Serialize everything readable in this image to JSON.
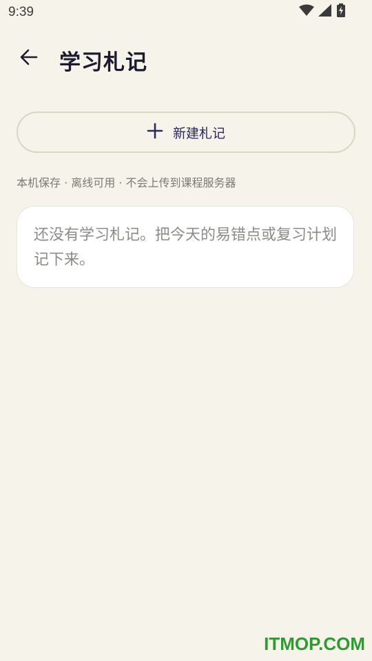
{
  "status_bar": {
    "time": "9:39",
    "icons": [
      "wifi-icon",
      "cellular-signal-icon",
      "battery-charging-icon"
    ]
  },
  "app_bar": {
    "back_icon": "arrow-left-icon",
    "title": "学习札记"
  },
  "actions": {
    "new_note_label": "新建札记",
    "new_note_icon": "plus-icon"
  },
  "storage_hint": "本机保存 · 离线可用 · 不会上传到课程服务器",
  "empty_state": {
    "message": "还没有学习札记。把今天的易错点或复习计划记下来。"
  },
  "watermark": "ITMOP.COM",
  "colors": {
    "background": "#f6f3ea",
    "card": "#ffffff",
    "accent_text": "#2c2a5a",
    "watermark": "#2f9a2f"
  }
}
